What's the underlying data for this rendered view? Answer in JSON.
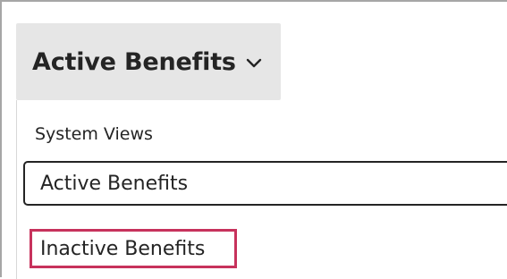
{
  "view_selector": {
    "label": "Active Benefits",
    "icon": "chevron-down-icon"
  },
  "flyout": {
    "section_header": "System Views",
    "items": [
      {
        "label": "Active Benefits",
        "selected": true
      },
      {
        "label": "Inactive Benefits",
        "selected": false,
        "highlighted": true
      }
    ]
  },
  "colors": {
    "selector_background": "#e6e6e6",
    "highlight_border": "#c7325c",
    "selected_border": "#242424"
  }
}
